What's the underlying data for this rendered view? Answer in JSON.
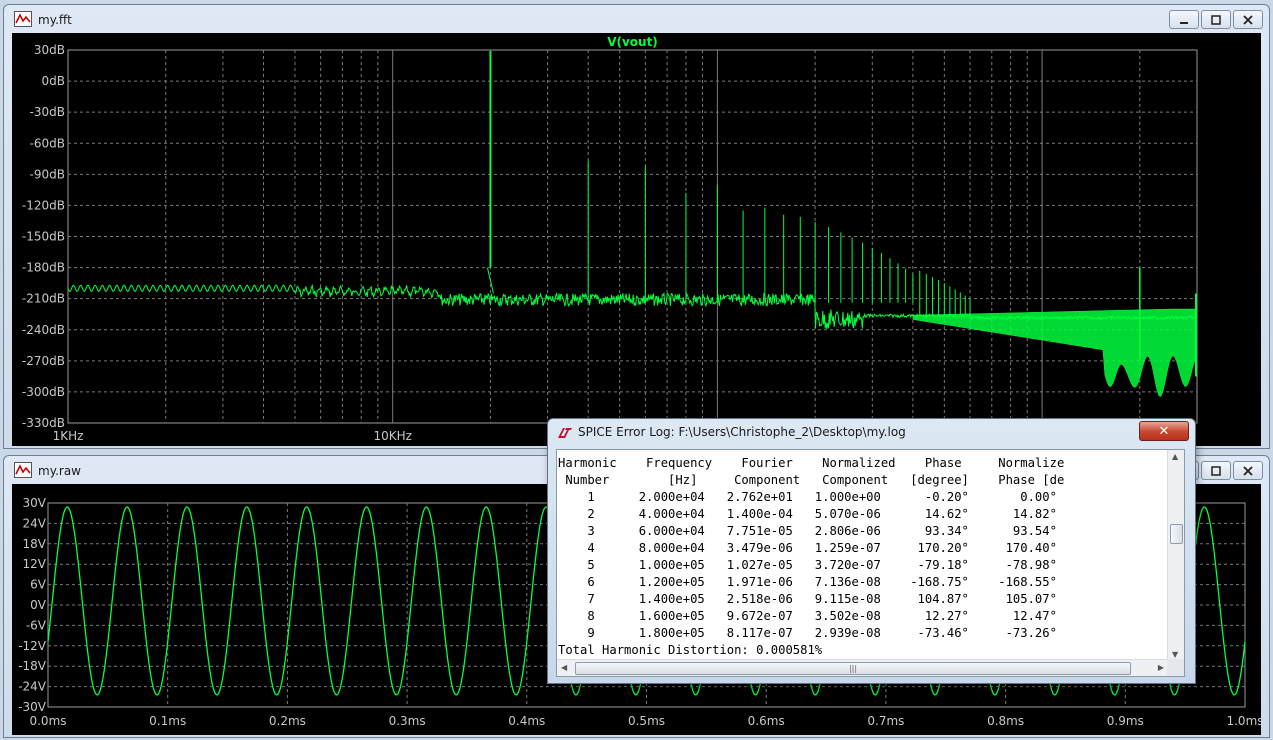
{
  "fft_window": {
    "title": "my.fft",
    "trace_name": "V(vout)",
    "y_ticks": [
      "30dB",
      "0dB",
      "-30dB",
      "-60dB",
      "-90dB",
      "-120dB",
      "-150dB",
      "-180dB",
      "-210dB",
      "-240dB",
      "-270dB",
      "-300dB",
      "-330dB"
    ],
    "x_ticks": [
      "1KHz",
      "10KHz",
      "100KHz"
    ],
    "trace_color": "#00ff3c"
  },
  "raw_window": {
    "title": "my.raw",
    "y_ticks": [
      "30V",
      "24V",
      "18V",
      "12V",
      "6V",
      "0V",
      "-6V",
      "-12V",
      "-18V",
      "-24V",
      "-30V"
    ],
    "x_ticks": [
      "0.0ms",
      "0.1ms",
      "0.2ms",
      "0.3ms",
      "0.4ms",
      "0.5ms",
      "0.6ms",
      "0.7ms",
      "0.8ms",
      "0.9ms",
      "1.0ms"
    ],
    "trace_color": "#00ff3c"
  },
  "chart_data": [
    {
      "type": "line",
      "title": "V(vout)",
      "xlabel": "",
      "ylabel": "",
      "x_scale": "log",
      "xlim": [
        1000,
        3000000
      ],
      "ylim": [
        -330,
        30
      ],
      "grid": true,
      "fundamental_hz": 20000,
      "noise_floor_db": -205,
      "peaks": [
        {
          "freq_hz": 20000,
          "db": 29
        },
        {
          "freq_hz": 40000,
          "db": -77
        },
        {
          "freq_hz": 60000,
          "db": -82
        },
        {
          "freq_hz": 80000,
          "db": -108
        },
        {
          "freq_hz": 100000,
          "db": -100
        },
        {
          "freq_hz": 120000,
          "db": -125
        },
        {
          "freq_hz": 140000,
          "db": -122
        },
        {
          "freq_hz": 160000,
          "db": -129
        },
        {
          "freq_hz": 180000,
          "db": -131
        }
      ]
    },
    {
      "type": "line",
      "title": "",
      "xlabel": "",
      "ylabel": "",
      "xlim": [
        0.0,
        1.0
      ],
      "ylim": [
        -30,
        30
      ],
      "grid": true,
      "signal": {
        "kind": "sine",
        "frequency_hz": 20000,
        "amplitude_v": 27.62,
        "offset_v": 1.2,
        "time_unit": "ms"
      }
    }
  ],
  "error_log": {
    "title": "SPICE Error Log: F:\\Users\\Christophe_2\\Desktop\\my.log",
    "close_label": "✕",
    "text": "Harmonic    Frequency    Fourier    Normalized    Phase     Normalize\n Number        [Hz]     Component   Component   [degree]    Phase [de\n    1      2.000e+04   2.762e+01   1.000e+00      -0.20°       0.00°\n    2      4.000e+04   1.400e-04   5.070e-06      14.62°      14.82°\n    3      6.000e+04   7.751e-05   2.806e-06      93.34°      93.54°\n    4      8.000e+04   3.479e-06   1.259e-07     170.20°     170.40°\n    5      1.000e+05   1.027e-05   3.720e-07     -79.18°     -78.98°\n    6      1.200e+05   1.971e-06   7.136e-08    -168.75°    -168.55°\n    7      1.400e+05   2.518e-06   9.115e-08     104.87°     105.07°\n    8      1.600e+05   9.672e-07   3.502e-08      12.27°      12.47°\n    9      1.800e+05   8.117e-07   2.939e-08     -73.46°     -73.26°\nTotal Harmonic Distortion: 0.000581%"
  }
}
